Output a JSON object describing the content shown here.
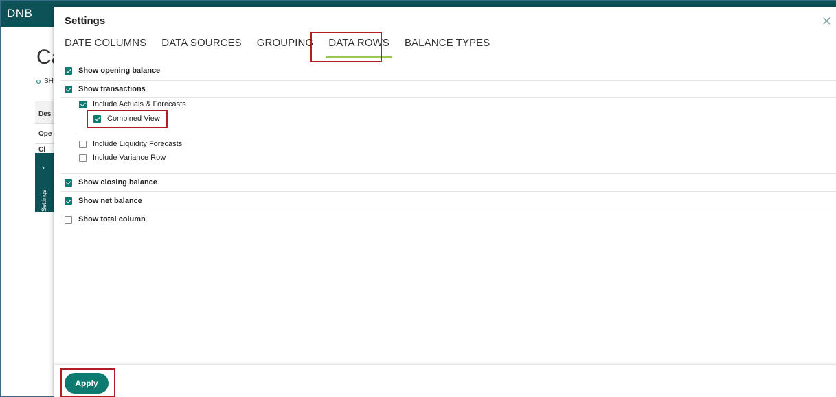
{
  "app": {
    "logo_text": "DNB",
    "page_title_partial": "Ca",
    "subtitle_partial": "SH",
    "table_header_partial": "Des",
    "table_row_partial": "Ope",
    "table_row2_partial": "Cl",
    "side_tab_label": "Settings",
    "side_tab_icon": "chevron-right-icon"
  },
  "modal": {
    "title": "Settings",
    "close_icon": "close-icon",
    "tabs": [
      {
        "label": "DATE COLUMNS",
        "active": false
      },
      {
        "label": "DATA SOURCES",
        "active": false
      },
      {
        "label": "GROUPING",
        "active": false
      },
      {
        "label": "DATA ROWS",
        "active": true
      },
      {
        "label": "BALANCE TYPES",
        "active": false
      }
    ],
    "options": {
      "opening_balance": {
        "label": "Show opening balance",
        "checked": true
      },
      "transactions": {
        "label": "Show transactions",
        "checked": true
      },
      "actuals_forecasts": {
        "label": "Include Actuals & Forecasts",
        "checked": true
      },
      "combined_view": {
        "label": "Combined View",
        "checked": true
      },
      "liquidity_forecasts": {
        "label": "Include Liquidity Forecasts",
        "checked": false
      },
      "variance_row": {
        "label": "Include Variance Row",
        "checked": false
      },
      "closing_balance": {
        "label": "Show closing balance",
        "checked": true
      },
      "net_balance": {
        "label": "Show net balance",
        "checked": true
      },
      "total_column": {
        "label": "Show total column",
        "checked": false
      }
    },
    "apply_label": "Apply"
  },
  "colors": {
    "brand_dark": "#0d5257",
    "accent_teal": "#0d7a70",
    "active_underline": "#9bc94b",
    "highlight_red": "#b11d25"
  }
}
